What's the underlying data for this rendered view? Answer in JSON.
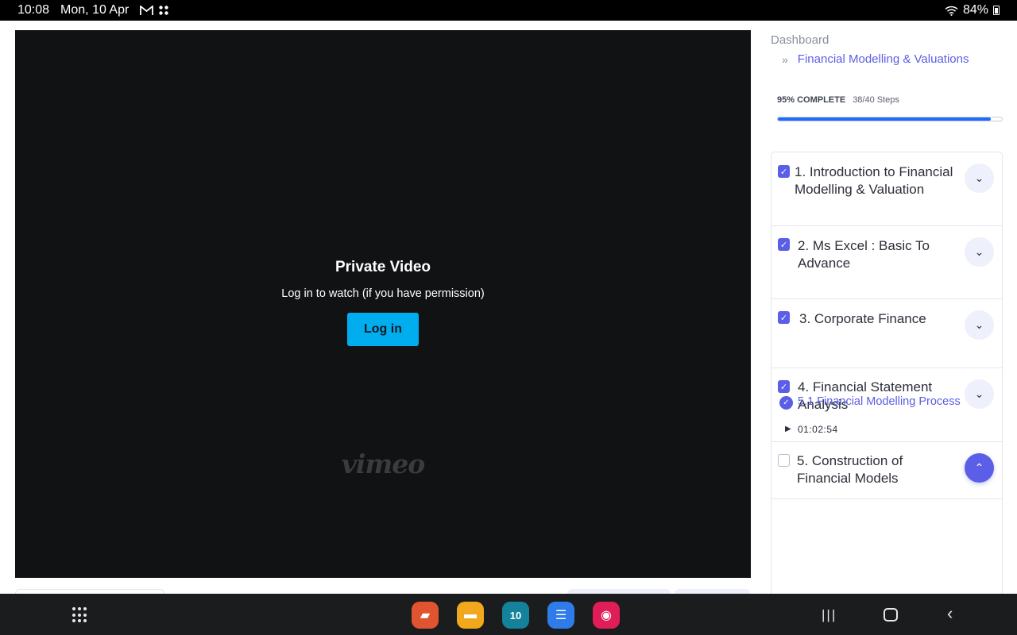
{
  "status_bar": {
    "time": "10:08",
    "date": "Mon, 10 Apr",
    "battery": "84%",
    "icons": [
      "gmail-icon",
      "app-grid-icon",
      "wifi-icon",
      "battery-icon"
    ]
  },
  "video": {
    "title": "Private Video",
    "subtitle": "Log in to watch (if you have permission)",
    "login_label": "Log in",
    "logo_text": "vimeo",
    "accent_color": "#00adef"
  },
  "sidebar": {
    "breadcrumb_home": "Dashboard",
    "breadcrumb_separator": "»",
    "breadcrumb_course": "Financial Modelling & Valuations",
    "progress_percent_label": "95% COMPLETE",
    "progress_steps": "38/40 Steps",
    "progress_fraction": 0.95,
    "modules": [
      {
        "title": "1. Introduction to Financial Modelling & Valuation",
        "checked": true,
        "expanded": false
      },
      {
        "title": "2. Ms Excel : Basic To Advance",
        "checked": true,
        "expanded": false
      },
      {
        "title": "3. Corporate Finance",
        "checked": true,
        "expanded": false
      },
      {
        "title": "4. Financial Statement Analysis",
        "checked": true,
        "expanded": false
      },
      {
        "title": "5. Construction of Financial Models",
        "checked": false,
        "expanded": true
      }
    ],
    "current_lesson": {
      "title": "5.1 Financial Modelling Process",
      "duration": "01:02:54"
    },
    "accent_color": "#5b5ee6"
  },
  "nav_bar": {
    "dock_apps": [
      {
        "name": "notes-app-icon",
        "color": "#e0552f",
        "glyph": "▰"
      },
      {
        "name": "files-app-icon",
        "color": "#f2a81d",
        "glyph": "▬"
      },
      {
        "name": "calendar-app-icon",
        "color": "#14829a",
        "glyph": "10"
      },
      {
        "name": "messages-app-icon",
        "color": "#2f7bea",
        "glyph": "☰"
      },
      {
        "name": "camera-app-icon",
        "color": "#e11d57",
        "glyph": "◉"
      }
    ]
  }
}
